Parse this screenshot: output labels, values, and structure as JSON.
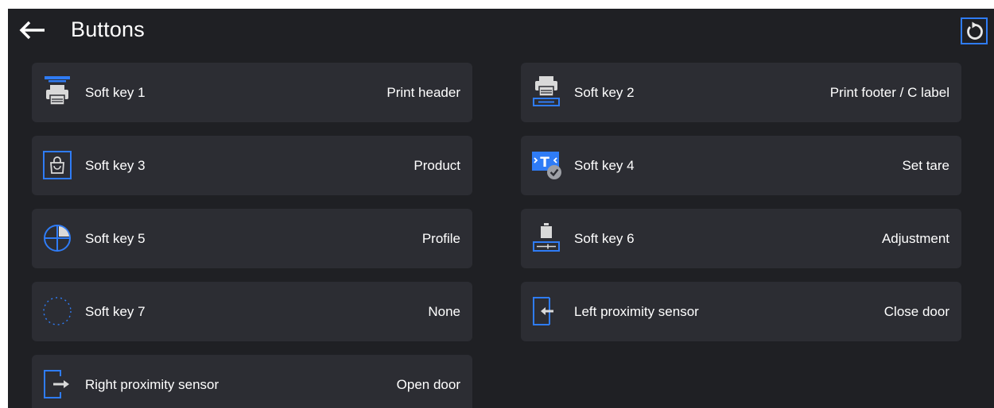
{
  "header": {
    "title": "Buttons",
    "back_icon": "arrow-left-icon",
    "reset_icon": "reset-icon"
  },
  "colors": {
    "background": "#1f2024",
    "tile": "#2c2d33",
    "accent": "#2f7cf6",
    "text": "#ffffff",
    "icon_gray": "#d9d9d9"
  },
  "buttons": [
    {
      "key": "Soft key 1",
      "value": "Print header",
      "icon": "print-header-icon"
    },
    {
      "key": "Soft key 2",
      "value": "Print footer / C label",
      "icon": "print-footer-icon"
    },
    {
      "key": "Soft key 3",
      "value": "Product",
      "icon": "product-bag-icon"
    },
    {
      "key": "Soft key 4",
      "value": "Set tare",
      "icon": "set-tare-icon"
    },
    {
      "key": "Soft key 5",
      "value": "Profile",
      "icon": "profile-icon"
    },
    {
      "key": "Soft key 6",
      "value": "Adjustment",
      "icon": "adjustment-icon"
    },
    {
      "key": "Soft key 7",
      "value": "None",
      "icon": "none-icon"
    },
    {
      "key": "Left proximity sensor",
      "value": "Close door",
      "icon": "close-door-icon"
    },
    {
      "key": "Right proximity sensor",
      "value": "Open door",
      "icon": "open-door-icon"
    }
  ]
}
